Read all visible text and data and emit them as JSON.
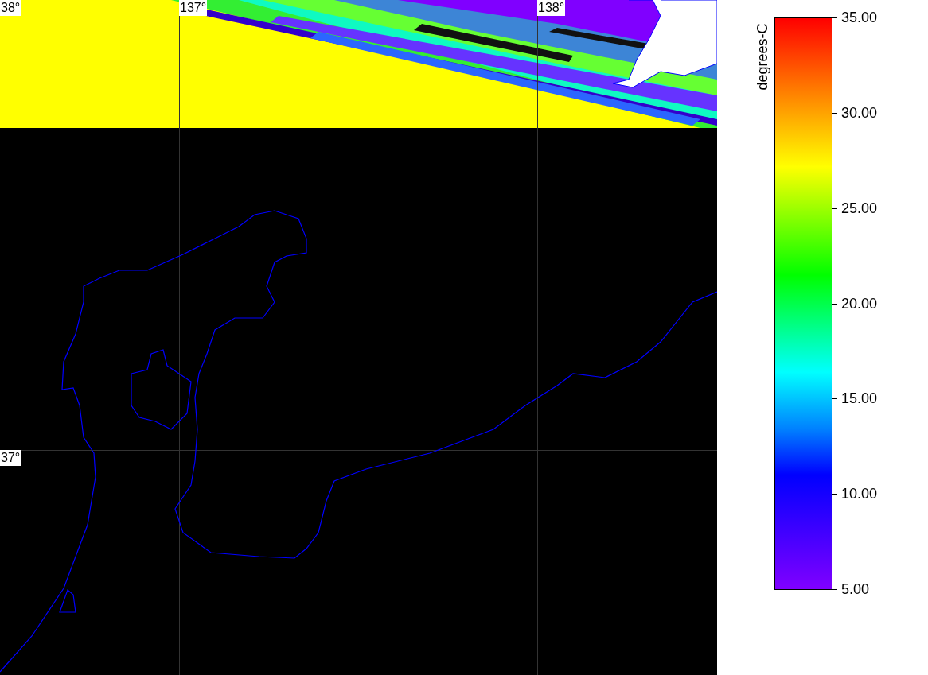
{
  "map": {
    "grid_labels": [
      {
        "text": "38°"
      },
      {
        "text": "137°"
      },
      {
        "text": "138°"
      },
      {
        "text": "37°"
      }
    ]
  },
  "colorbar": {
    "title": "degrees-C",
    "ticks": [
      "35.00",
      "30.00",
      "25.00",
      "20.00",
      "15.00",
      "10.00",
      "5.00"
    ]
  }
}
